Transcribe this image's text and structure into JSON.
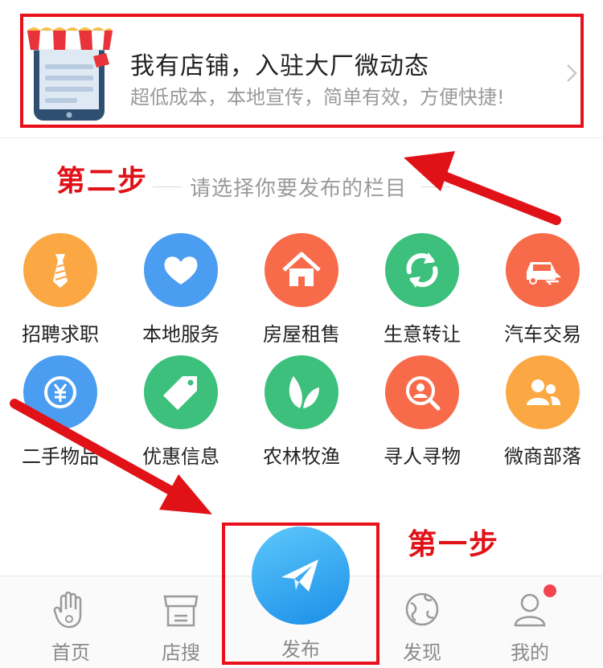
{
  "banner": {
    "title": "我有店铺，入驻大厂微动态",
    "subtitle": "超低成本，本地宣传，简单有效，方便快捷!"
  },
  "section": {
    "title": "请选择你要发布的栏目"
  },
  "annotations": {
    "step1": "第一步",
    "step2": "第二步"
  },
  "categories": [
    {
      "label": "招聘求职",
      "icon": "tie-icon",
      "color": "#fba844"
    },
    {
      "label": "本地服务",
      "icon": "heart-icon",
      "color": "#4a9df0"
    },
    {
      "label": "房屋租售",
      "icon": "house-icon",
      "color": "#f86b4a"
    },
    {
      "label": "生意转让",
      "icon": "refresh-icon",
      "color": "#3cc07c"
    },
    {
      "label": "汽车交易",
      "icon": "car-icon",
      "color": "#f86b4a"
    },
    {
      "label": "二手物品",
      "icon": "yen-cycle-icon",
      "color": "#4a9df0"
    },
    {
      "label": "优惠信息",
      "icon": "tag-icon",
      "color": "#3cc07c"
    },
    {
      "label": "农林牧渔",
      "icon": "leaf-icon",
      "color": "#3cc07c"
    },
    {
      "label": "寻人寻物",
      "icon": "search-person-icon",
      "color": "#f86b4a"
    },
    {
      "label": "微商部落",
      "icon": "people-icon",
      "color": "#fba844"
    }
  ],
  "tabs": [
    {
      "label": "首页",
      "icon": "hand-icon"
    },
    {
      "label": "店搜",
      "icon": "store-icon"
    },
    {
      "label": "发布",
      "icon": "paper-plane-icon"
    },
    {
      "label": "发现",
      "icon": "globe-icon"
    },
    {
      "label": "我的",
      "icon": "user-icon"
    }
  ],
  "colors": {
    "highlight_red": "#e8101a",
    "publish_blue": "#2a9cef",
    "badge_red": "#f2454f"
  }
}
